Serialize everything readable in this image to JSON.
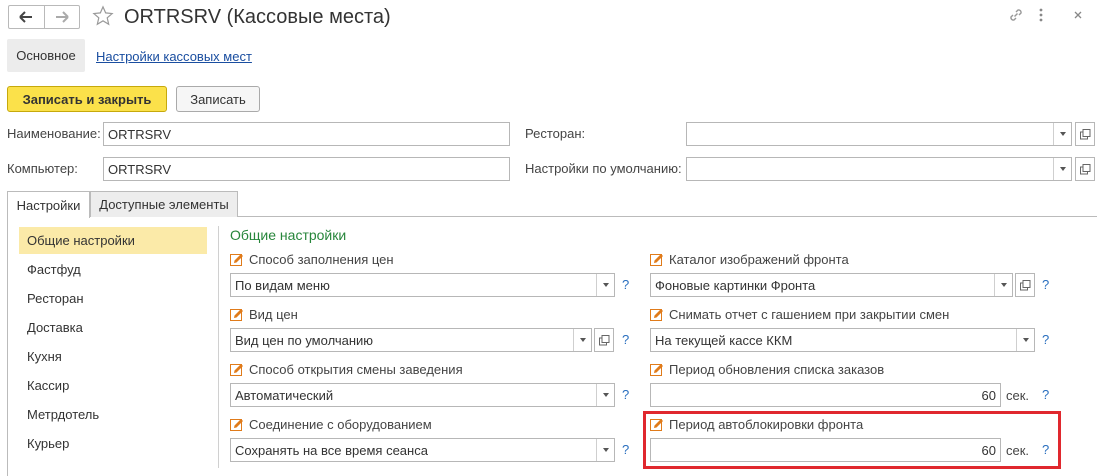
{
  "window": {
    "title": "ORTRSRV (Кассовые места)"
  },
  "section_tabs": {
    "main": "Основное",
    "settings_link": "Настройки кассовых мест"
  },
  "commands": {
    "save_close": "Записать и закрыть",
    "save": "Записать"
  },
  "header": {
    "name_label": "Наименование:",
    "name_value": "ORTRSRV",
    "computer_label": "Компьютер:",
    "computer_value": "ORTRSRV",
    "restaurant_label": "Ресторан:",
    "restaurant_value": "",
    "defaults_label": "Настройки по умолчанию:",
    "defaults_value": ""
  },
  "tabs": [
    {
      "label": "Настройки"
    },
    {
      "label": "Доступные элементы"
    }
  ],
  "sidebar": {
    "items": [
      {
        "label": "Общие настройки"
      },
      {
        "label": "Фастфуд"
      },
      {
        "label": "Ресторан"
      },
      {
        "label": "Доставка"
      },
      {
        "label": "Кухня"
      },
      {
        "label": "Кассир"
      },
      {
        "label": "Метрдотель"
      },
      {
        "label": "Курьер"
      }
    ]
  },
  "general": {
    "title": "Общие настройки",
    "price_fill": {
      "label": "Способ заполнения цен",
      "value": "По видам меню"
    },
    "price_type": {
      "label": "Вид цен",
      "value": "Вид цен по умолчанию"
    },
    "shift_open": {
      "label": "Способ открытия смены заведения",
      "value": "Автоматический"
    },
    "equipment": {
      "label": "Соединение с оборудованием",
      "value": "Сохранять на все время сеанса"
    },
    "image_catalog": {
      "label": "Каталог изображений фронта",
      "value": "Фоновые картинки Фронта"
    },
    "report_close": {
      "label": "Снимать отчет с гашением при закрытии смен",
      "value": "На текущей кассе ККМ"
    },
    "orders_refresh": {
      "label": "Период обновления списка заказов",
      "value": "60",
      "unit": "сек."
    },
    "autolock": {
      "label": "Период автоблокировки фронта",
      "value": "60",
      "unit": "сек."
    },
    "help": "?"
  },
  "colors": {
    "primary_button": "#fbe14a",
    "accent_green": "#27863b",
    "link": "#1a4ea0",
    "highlight_frame": "#e0282e"
  }
}
